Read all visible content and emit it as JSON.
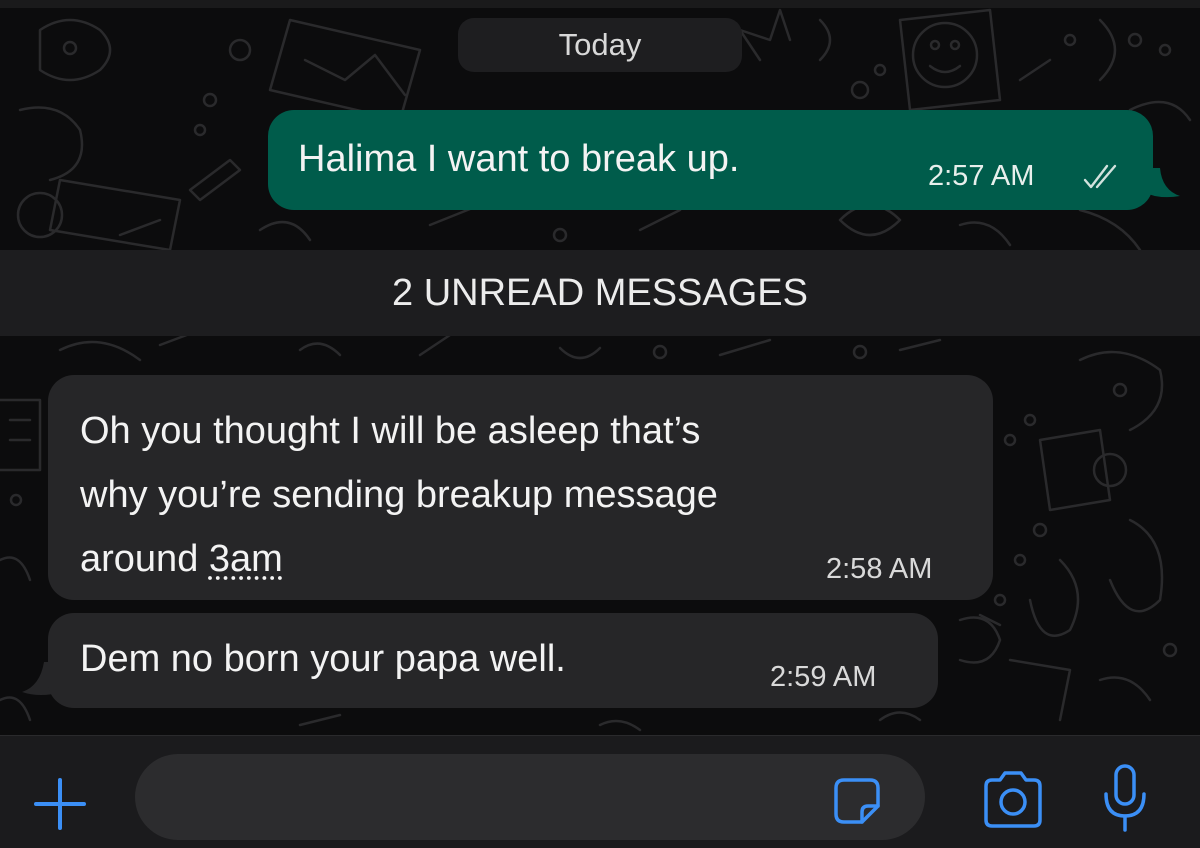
{
  "header": {
    "date_separator": "Today"
  },
  "messages": [
    {
      "direction": "outgoing",
      "text": "Halima I want to break up.",
      "time": "2:57 AM",
      "status": "read"
    },
    {
      "direction": "incoming",
      "lines": [
        "Oh you thought I will be asleep that’s",
        "why you’re sending breakup message",
        "around "
      ],
      "link_text": "3am",
      "time": "2:58 AM"
    },
    {
      "direction": "incoming",
      "text": "Dem no born your papa well.",
      "time": "2:59 AM"
    }
  ],
  "unread_divider": "2 UNREAD MESSAGES",
  "composer": {
    "placeholder": "",
    "icons": [
      "plus-icon",
      "sticker-icon",
      "camera-icon",
      "microphone-icon"
    ]
  },
  "colors": {
    "outgoing_bubble": "#005c4b",
    "incoming_bubble": "#262628",
    "accent": "#3b8ff6",
    "background": "#0c0c0d"
  }
}
